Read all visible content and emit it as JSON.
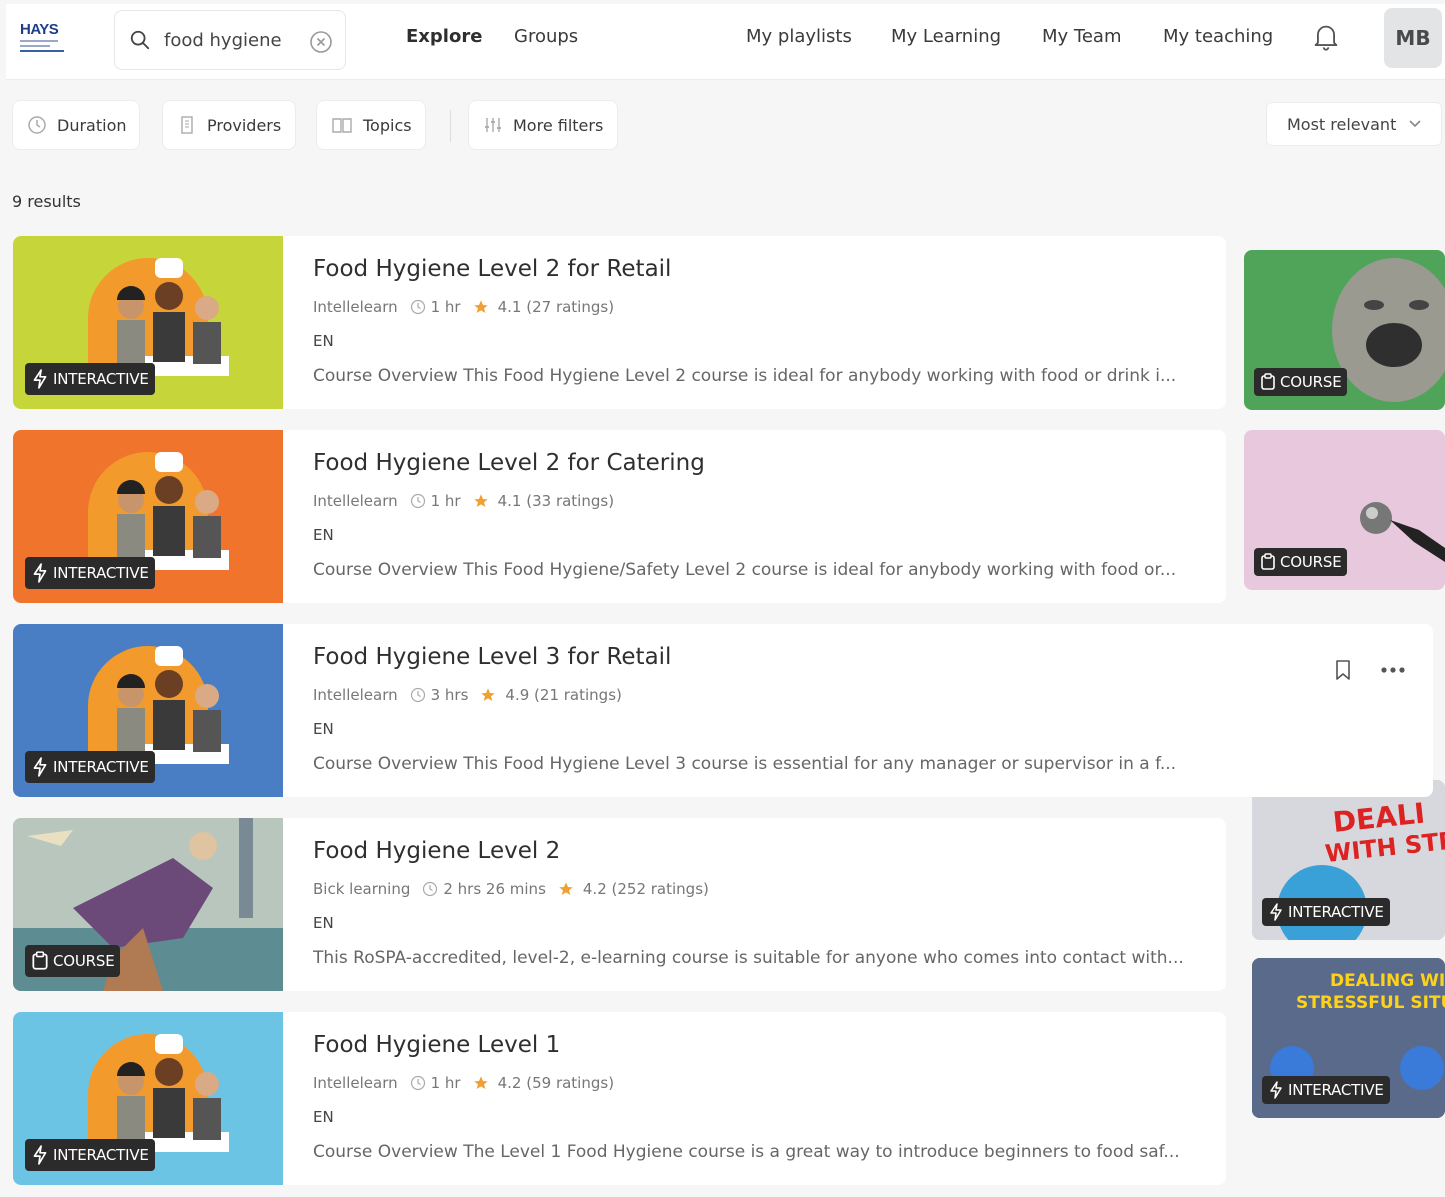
{
  "header": {
    "brand": "HAYS",
    "search_value": "food hygiene",
    "nav_left": [
      "Explore",
      "Groups"
    ],
    "nav_right": [
      "My playlists",
      "My Learning",
      "My Team",
      "My teaching"
    ],
    "avatar_initials": "MB"
  },
  "filters": {
    "duration": "Duration",
    "providers": "Providers",
    "topics": "Topics",
    "more": "More filters",
    "sort": "Most relevant"
  },
  "results_count": "9 results",
  "badges": {
    "interactive": "INTERACTIVE",
    "course": "COURSE"
  },
  "cards": [
    {
      "title": "Food Hygiene Level 2 for Retail",
      "provider": "Intellelearn",
      "duration": "1 hr",
      "rating": "4.1 (27 ratings)",
      "lang": "EN",
      "desc": "Course Overview This Food Hygiene Level 2 course is ideal for anybody working with food or drink i...",
      "badge": "INTERACTIVE",
      "thumb_color": "#c6d63a"
    },
    {
      "title": "Food Hygiene Level 2 for Catering",
      "provider": "Intellelearn",
      "duration": "1 hr",
      "rating": "4.1 (33 ratings)",
      "lang": "EN",
      "desc": "Course Overview This Food Hygiene/Safety Level 2 course is ideal for anybody working with food or...",
      "badge": "INTERACTIVE",
      "thumb_color": "#f0742b"
    },
    {
      "title": "Food Hygiene Level 3 for Retail",
      "provider": "Intellelearn",
      "duration": "3 hrs",
      "rating": "4.9 (21 ratings)",
      "lang": "EN",
      "desc": "Course Overview This Food Hygiene Level 3 course is essential for any manager or supervisor in a f...",
      "badge": "INTERACTIVE",
      "thumb_color": "#4a7ec4"
    },
    {
      "title": "Food Hygiene Level 2",
      "provider": "Bick learning",
      "duration": "2 hrs 26 mins",
      "rating": "4.2 (252 ratings)",
      "lang": "EN",
      "desc": "This RoSPA-accredited, level-2, e-learning course is suitable for anyone who comes into contact with...",
      "badge": "COURSE",
      "thumb_color": "#9fb8b4"
    },
    {
      "title": "Food Hygiene Level 1",
      "provider": "Intellelearn",
      "duration": "1 hr",
      "rating": "4.2 (59 ratings)",
      "lang": "EN",
      "desc": "Course Overview The Level 1 Food Hygiene course is a great way to introduce beginners to food saf...",
      "badge": "INTERACTIVE",
      "thumb_color": "#6cc4e4"
    }
  ],
  "side_thumbs": [
    {
      "badge": "COURSE"
    },
    {
      "badge": "COURSE"
    },
    {
      "badge": "INTERACTIVE",
      "art_text": [
        "DEALI",
        "WITH STR"
      ]
    },
    {
      "badge": "INTERACTIVE",
      "art_text": [
        "DEALING WITH",
        "STRESSFUL SITUATIO"
      ]
    }
  ],
  "colors": {
    "star": "#f0a030",
    "badge_bg": "#2b2b2b"
  }
}
